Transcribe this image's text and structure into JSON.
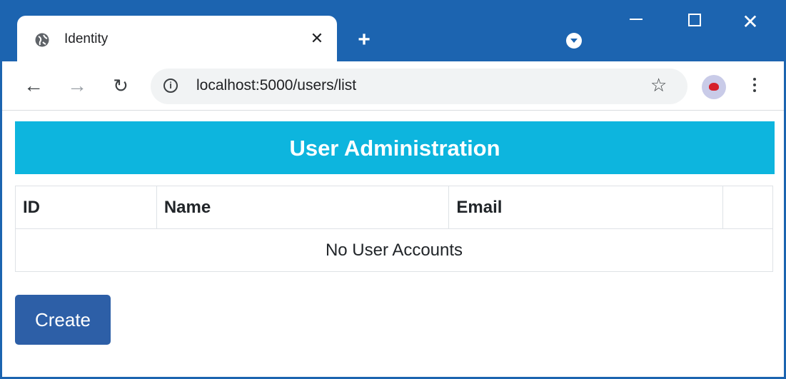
{
  "browser": {
    "tab_title": "Identity",
    "url": "localhost:5000/users/list",
    "accent": "#1c64b0"
  },
  "page": {
    "header": "User Administration",
    "header_color": "#0db5de",
    "table": {
      "columns": [
        "ID",
        "Name",
        "Email",
        ""
      ],
      "empty_message": "No User Accounts"
    },
    "create_label": "Create",
    "button_color": "#2d5fa7"
  },
  "icons": {
    "tab": "globe-icon",
    "close": "close-icon",
    "new_tab": "plus-icon",
    "tab_search": "tab-search-icon",
    "back": "back-arrow-icon",
    "forward": "forward-arrow-icon",
    "reload": "reload-icon",
    "info": "info-icon",
    "bookmark": "star-icon",
    "menu": "kebab-menu-icon"
  }
}
